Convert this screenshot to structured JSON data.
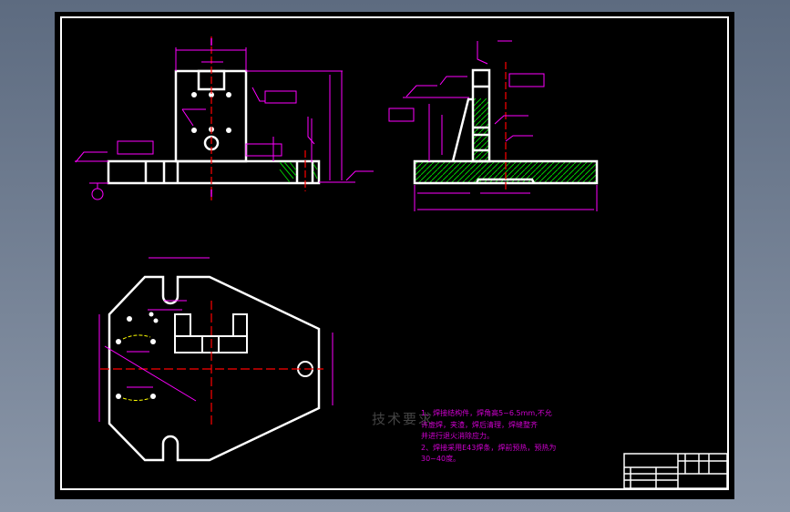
{
  "drawing": {
    "requirements_title": "技术要求",
    "requirements": [
      "1、焊接结构件，焊角高5~6.5mm,不允许虚焊，夹渣，焊后清理，焊缝整齐",
      "并进行退火消除应力。",
      "2、焊接采用E43焊条，焊前预热，预热为",
      "30~40度。"
    ],
    "colors": {
      "outline": "#ffffff",
      "dimension": "#ff00ff",
      "centerline": "#ff0000",
      "hatch": "#00cc00",
      "background": "#000000"
    }
  }
}
